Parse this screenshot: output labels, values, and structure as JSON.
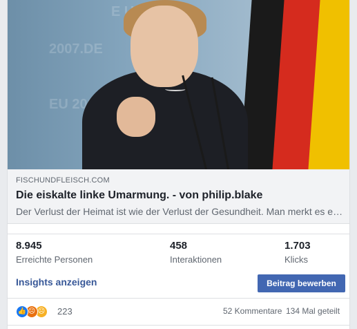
{
  "link_preview": {
    "domain": "FISCHUNDFLEISCH.COM",
    "title": "Die eiskalte linke Umarmung. - von philip.blake",
    "description": "Der Verlust der Heimat ist wie der Verlust der Gesundheit. Man merkt es erst, wenn man sie verloren hat."
  },
  "stats": [
    {
      "value": "8.945",
      "label": "Erreichte Personen"
    },
    {
      "value": "458",
      "label": "Interaktionen"
    },
    {
      "value": "1.703",
      "label": "Klicks"
    }
  ],
  "actions": {
    "insights_label": "Insights anzeigen",
    "promote_label": "Beitrag bewerben"
  },
  "engagement": {
    "reaction_count": "223",
    "comments": "52 Kommentare",
    "shares": "134 Mal geteilt",
    "reaction_icons": [
      "like-icon",
      "angry-icon",
      "sad-icon"
    ]
  },
  "colors": {
    "link_blue": "#385898",
    "button_blue": "#4267b2",
    "flag_black": "#1a1a1a",
    "flag_red": "#d52b1e",
    "flag_gold": "#f0c000"
  }
}
